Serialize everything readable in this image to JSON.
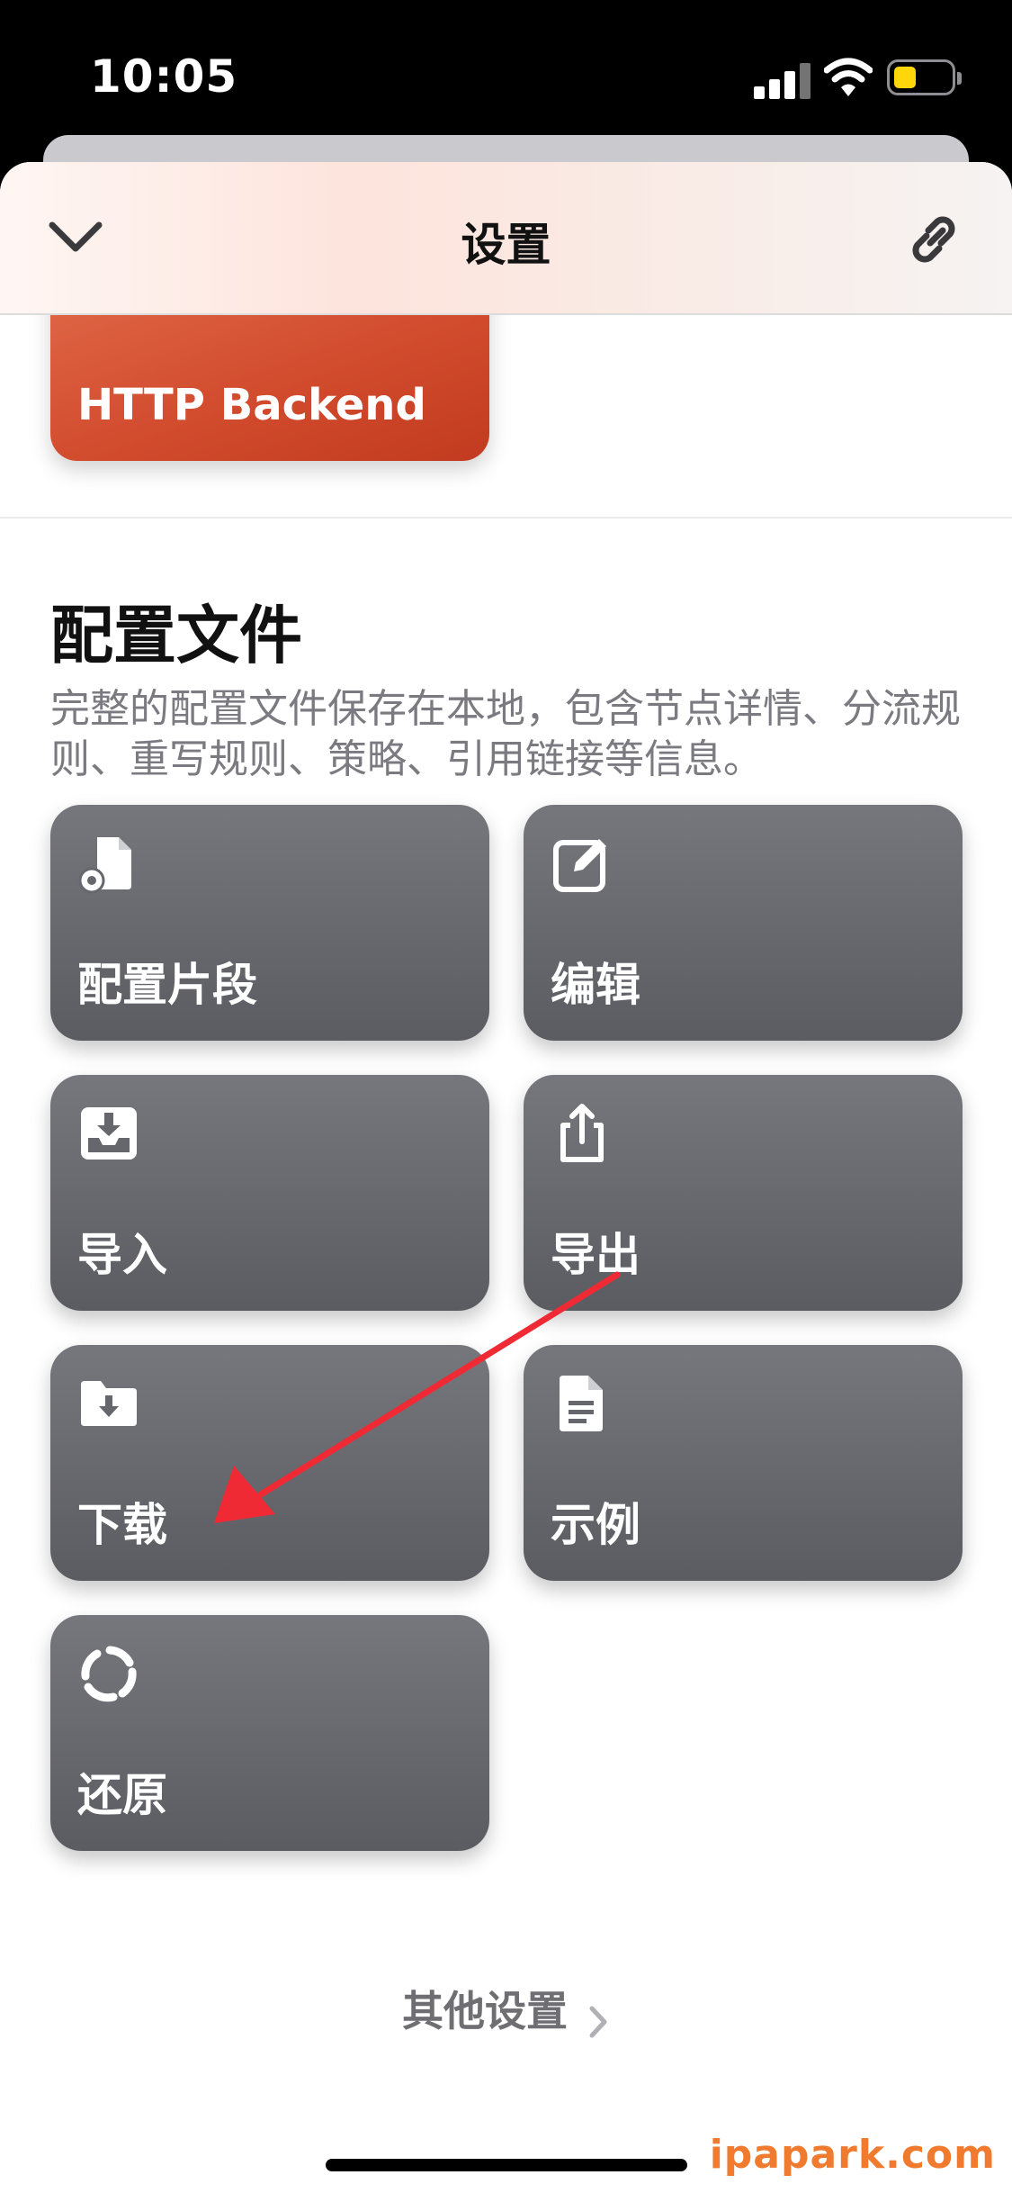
{
  "status_bar": {
    "time": "10:05"
  },
  "nav": {
    "title": "设置"
  },
  "http_card": {
    "label": "HTTP Backend"
  },
  "section": {
    "title": "配置文件",
    "description": "完整的配置文件保存在本地，包含节点详情、分流规则、重写规则、策略、引用链接等信息。"
  },
  "tiles": [
    {
      "label": "配置片段",
      "icon": "file-gear-icon"
    },
    {
      "label": "编辑",
      "icon": "edit-icon"
    },
    {
      "label": "导入",
      "icon": "import-icon"
    },
    {
      "label": "导出",
      "icon": "share-icon"
    },
    {
      "label": "下载",
      "icon": "folder-download-icon"
    },
    {
      "label": "示例",
      "icon": "document-icon"
    },
    {
      "label": "还原",
      "icon": "restore-icon"
    }
  ],
  "other_settings": {
    "label": "其他设置"
  },
  "watermark": "ipapark.com",
  "colors": {
    "accent": "#d14a2c",
    "tile": "#66676c",
    "annotation": "#f02a35",
    "watermark": "#f07a2e"
  }
}
